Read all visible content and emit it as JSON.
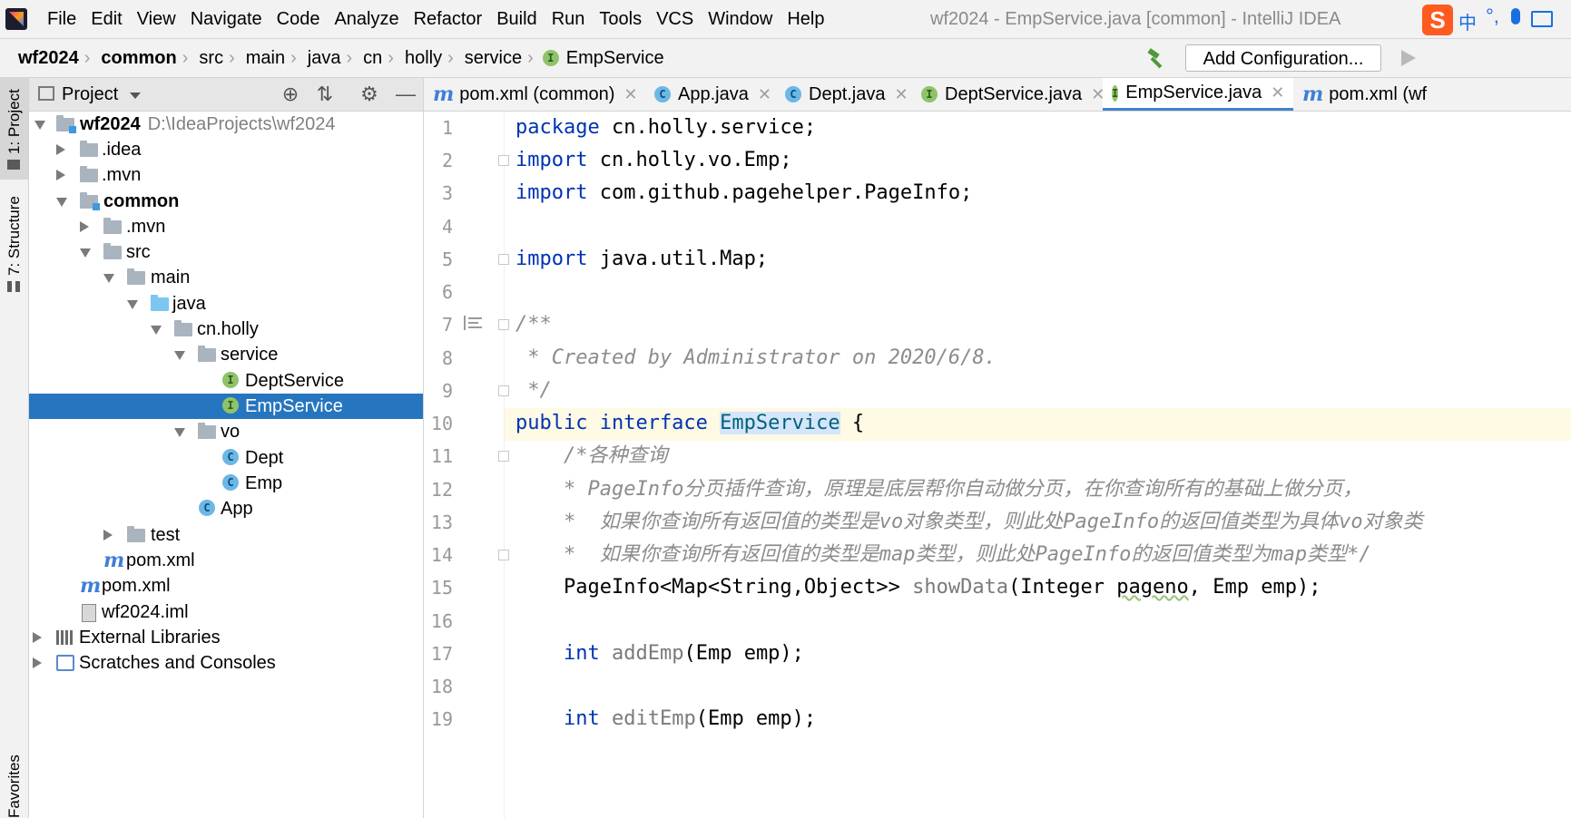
{
  "menubar": {
    "items": [
      "File",
      "Edit",
      "View",
      "Navigate",
      "Code",
      "Analyze",
      "Refactor",
      "Build",
      "Run",
      "Tools",
      "VCS",
      "Window",
      "Help"
    ],
    "window_title": "wf2024 - EmpService.java [common] - IntelliJ IDEA"
  },
  "navbar": {
    "breadcrumb": [
      "wf2024",
      "common",
      "src",
      "main",
      "java",
      "cn",
      "holly",
      "service",
      "EmpService"
    ],
    "add_configuration": "Add Configuration..."
  },
  "ime": {
    "logo": "S",
    "lang": "中",
    "punct": "°,"
  },
  "left_strip": {
    "project": "1: Project",
    "structure": "7: Structure",
    "favorites": "Favorites"
  },
  "project_panel": {
    "title": "Project",
    "tree": [
      {
        "label": "wf2024",
        "path": "D:\\IdeaProjects\\wf2024"
      },
      {
        "label": ".idea"
      },
      {
        "label": ".mvn"
      },
      {
        "label": "common"
      },
      {
        "label": ".mvn"
      },
      {
        "label": "src"
      },
      {
        "label": "main"
      },
      {
        "label": "java"
      },
      {
        "label": "cn.holly"
      },
      {
        "label": "service"
      },
      {
        "label": "DeptService"
      },
      {
        "label": "EmpService"
      },
      {
        "label": "vo"
      },
      {
        "label": "Dept"
      },
      {
        "label": "Emp"
      },
      {
        "label": "App"
      },
      {
        "label": "test"
      },
      {
        "label": "pom.xml"
      },
      {
        "label": "pom.xml"
      },
      {
        "label": "wf2024.iml"
      },
      {
        "label": "External Libraries"
      },
      {
        "label": "Scratches and Consoles"
      }
    ]
  },
  "tabs": [
    {
      "label": "pom.xml (common)",
      "icon": "maven-icon"
    },
    {
      "label": "App.java",
      "icon": "class-run-icon"
    },
    {
      "label": "Dept.java",
      "icon": "class-icon"
    },
    {
      "label": "DeptService.java",
      "icon": "interface-icon"
    },
    {
      "label": "EmpService.java",
      "icon": "interface-icon",
      "active": true
    },
    {
      "label": "pom.xml (wf",
      "icon": "maven-icon"
    }
  ],
  "editor": {
    "line_numbers": [
      "1",
      "2",
      "3",
      "4",
      "5",
      "6",
      "7",
      "8",
      "9",
      "10",
      "11",
      "12",
      "13",
      "14",
      "15",
      "16",
      "17",
      "18",
      "19"
    ],
    "current_line": "10",
    "code": {
      "l1_kw": "package",
      "l1_rest": " cn.holly.service;",
      "l2_kw": "import",
      "l2_rest": " cn.holly.vo.Emp;",
      "l3_kw": "import",
      "l3_rest": " com.github.pagehelper.PageInfo;",
      "l5_kw": "import",
      "l5_rest": " java.util.Map;",
      "l7": "/**",
      "l8": " * Created by Administrator on 2020/6/8.",
      "l9": " */",
      "l10_kw": "public interface ",
      "l10_name": "EmpService",
      "l10_rest": " {",
      "l11": "    /*各种查询",
      "l12": "    * PageInfo分页插件查询，原理是底层帮你自动做分页，在你查询所有的基础上做分页，",
      "l13": "    *  如果你查询所有返回值的类型是vo对象类型，则此处PageInfo的返回值类型为具体vo对象类",
      "l14": "    *  如果你查询所有返回值的类型是map类型，则此处PageInfo的返回值类型为map类型*/",
      "l15_a": "    PageInfo<Map<String,Object>> ",
      "l15_fn": "showData",
      "l15_b": "(Integer ",
      "l15_param": "pageno",
      "l15_c": ", Emp emp);",
      "l17_indent": "    ",
      "l17_kw": "int",
      "l17_sp": " ",
      "l17_fn": "addEmp",
      "l17_rest": "(Emp emp);",
      "l19_indent": "    ",
      "l19_kw": "int",
      "l19_sp": " ",
      "l19_fn": "editEmp",
      "l19_rest": "(Emp emp);"
    }
  },
  "colors": {
    "keyword": "#0033b3",
    "comment": "#8c8c8c",
    "selection": "#2675bf",
    "caret_line": "#fffae3"
  }
}
